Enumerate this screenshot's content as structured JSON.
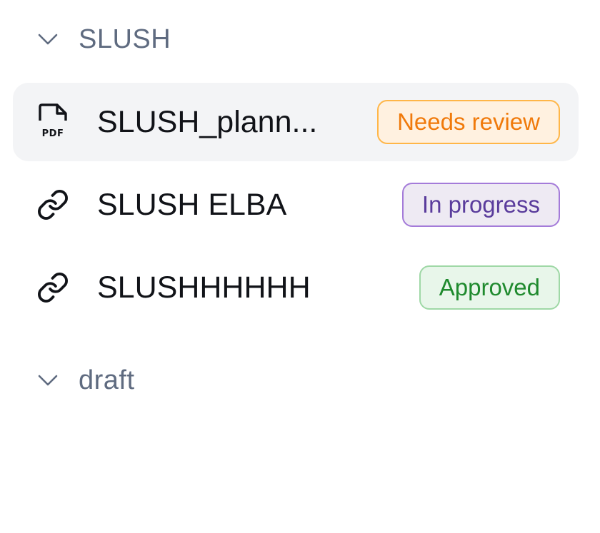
{
  "groups": [
    {
      "title": "SLUSH",
      "expanded": true,
      "items": [
        {
          "icon": "pdf-file-icon",
          "title": "SLUSH_plann...",
          "status": "Needs review",
          "status_color": "#f07a0b",
          "selected": true
        },
        {
          "icon": "link-icon",
          "title": "SLUSH ELBA",
          "status": "In progress",
          "status_color": "#5a3c9c",
          "selected": false
        },
        {
          "icon": "link-icon",
          "title": "SLUSHHHHHH",
          "status": "Approved",
          "status_color": "#1f8a2e",
          "selected": false
        }
      ]
    },
    {
      "title": "draft",
      "expanded": true,
      "items": []
    }
  ],
  "icons": {
    "pdf_label": "PDF"
  }
}
